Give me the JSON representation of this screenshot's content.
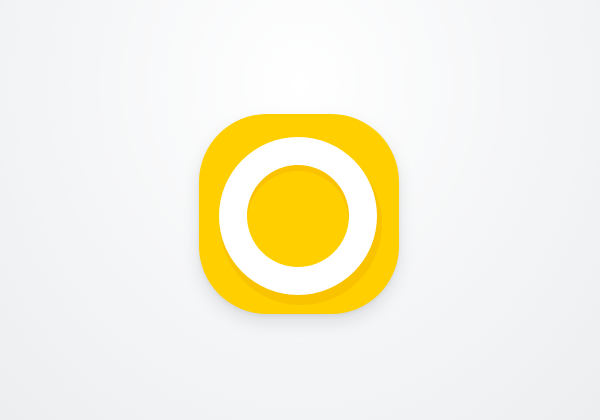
{
  "app_icon": {
    "icon_name": "circle-ring-icon",
    "colors": {
      "tile": "#FFCF00",
      "ring": "#FFFFFF",
      "ring_shadow": "#F7BF00",
      "center": "#FFCF00",
      "background": "#F1F2F3"
    }
  }
}
